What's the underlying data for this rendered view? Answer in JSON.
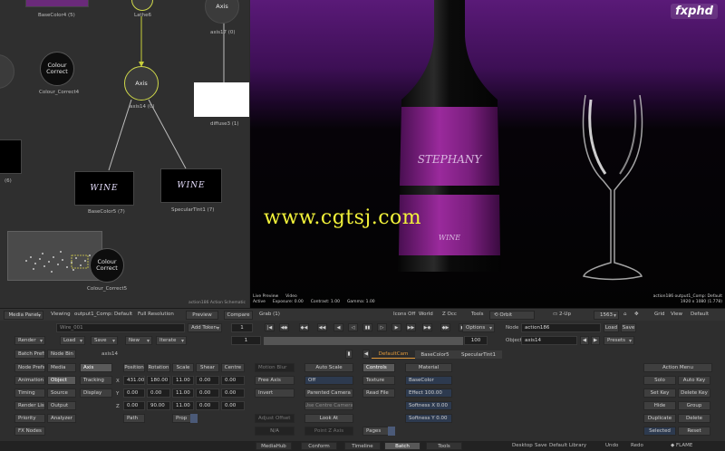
{
  "schematic": {
    "nodes": {
      "basecolor4": "BaseColor4 (5)",
      "lathe6": "Lathe6",
      "axis_top": "Axis",
      "axis_top_sub": "axis17 (0)",
      "cc1_title": "Colour Correct",
      "cc1_label": "Colour_Correct4",
      "axis_sel": "Axis",
      "axis_sel_sub": "axis14 (0)",
      "diffuse": "diffuse3 (1)",
      "basecolor5": "BaseColor5 (7)",
      "speculartint": "SpecularTint1 (7)",
      "cc2_title": "Colour Correct",
      "cc2_label": "Colour_Correct5",
      "side_num": "(6)",
      "wine_text": "WINE"
    },
    "footer": "action186 Action Schematic"
  },
  "viewport": {
    "watermark": "www.cgtsj.com",
    "brand": "fxphd",
    "label_text": "STEPHANY",
    "info_left": [
      "Live Preview",
      "Video"
    ],
    "info_left2": [
      "Active",
      "Exposure: 0.00",
      "Contrast: 1.00",
      "Gamma: 1.00"
    ],
    "info_right1": "action186 output1_Comp: Default",
    "info_right2": "1920 x 1080 (1.778)"
  },
  "toolbar1": {
    "media_panel": "Media Panel",
    "viewing": "Viewing",
    "output": "output1_Comp: Default",
    "full_res": "Full Resolution",
    "preview": "Preview",
    "compare": "Compare",
    "grab": "Grab (1)",
    "icons_off": "Icons Off",
    "world": "World",
    "zdcc": "Z Occ",
    "tools": "Tools",
    "orbit": "Orbit",
    "two_up": "2-Up",
    "zoom": "1563",
    "grid": "Grid",
    "view": "View",
    "default": "Default"
  },
  "controls": {
    "wire": "Wire_001",
    "add_token": "Add Token",
    "frame1": "1",
    "frame_end": "100",
    "options": "Options",
    "node_label": "Node",
    "node_value": "action186",
    "load": "Load",
    "save": "Save",
    "render": "Render",
    "load2": "Load",
    "save2": "Save",
    "new": "New",
    "iterate": "Iterate",
    "object_label": "Object",
    "object_value": "axis14",
    "presets": "Presets",
    "frame_cur": "1",
    "batch_prefs": "Batch Prefs",
    "node_bin": "Node Bin",
    "node_name": "axis14",
    "tab_default": "DefaultCam",
    "tab_base": "BaseColor5",
    "tab_spec": "SpecularTint1"
  },
  "left_col": {
    "items": [
      "Node Prefs",
      "Animation",
      "Timing",
      "Render List",
      "Priority",
      "FX Nodes"
    ],
    "col2": [
      "Media",
      "Object",
      "Source",
      "Output",
      "Analyzer"
    ],
    "col3": [
      "Axis",
      "Tracking",
      "Display"
    ]
  },
  "axis_panel": {
    "headers": [
      "Position",
      "Rotation",
      "Scale",
      "Shear",
      "Centre"
    ],
    "row_labels": [
      "X",
      "Y",
      "Z"
    ],
    "rows": [
      [
        "431.00",
        "180.00",
        "11.00",
        "0.00",
        "0.00"
      ],
      [
        "0.00",
        "0.00",
        "11.00",
        "0.00",
        "0.00"
      ],
      [
        "0.00",
        "90.00",
        "11.00",
        "0.00",
        "0.00"
      ]
    ],
    "path": "Path",
    "prop": "Prop"
  },
  "mid_panel": {
    "motion_blur": "Motion Blur",
    "free_axis": "Free Axis",
    "invert": "Invert",
    "adjust_offset": "Adjust Offset",
    "na": "N/A",
    "auto_scale": "Auto Scale",
    "off": "Off",
    "parented_camera": "Parented Camera",
    "use_centre_camera": "Use Centre Camera",
    "look_at": "Look At",
    "point_z_axis": "Point Z Axis"
  },
  "mat_panel": {
    "controls": "Controls",
    "texture": "Texture",
    "read_file": "Read File",
    "pages": "Pages",
    "material": "Material",
    "basecolor": "BaseColor",
    "effect": "Effect 100.00",
    "softness_x": "Softness X 0.00",
    "softness_y": "Softness Y 0.00"
  },
  "action_menu": {
    "title": "Action Menu",
    "buttons": [
      [
        "Solo",
        "Auto Key"
      ],
      [
        "Set Key",
        "Delete Key"
      ],
      [
        "Hide",
        "Group"
      ],
      [
        "Duplicate",
        "Delete"
      ],
      [
        "Selected",
        "Reset"
      ]
    ]
  },
  "bottom_tabs": [
    "MediaHub",
    "Conform",
    "Timeline",
    "Batch",
    "Tools"
  ],
  "bottom_right": {
    "desktop": "Desktop",
    "save": "Save",
    "default_library": "Default Library",
    "undo": "Undo",
    "redo": "Redo",
    "flame": "FLAME"
  },
  "colors": {
    "accent_orange": "#e39a3a",
    "axis_select": "#cfd84a",
    "watermark": "#f2f23a",
    "label_purple": "#8a1f8c"
  }
}
